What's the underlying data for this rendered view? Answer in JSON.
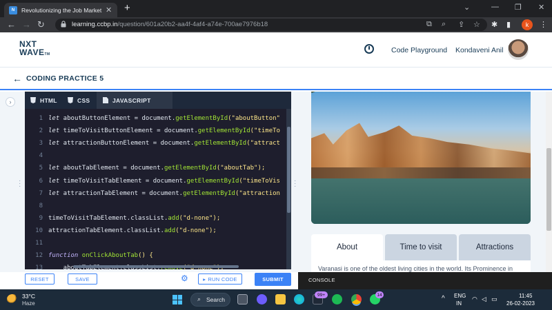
{
  "browser": {
    "tab_title": "Revolutionizing the Job Market | Nx",
    "url_host": "learning.ccbp.in",
    "url_path": "/question/601a20b2-aa4f-4af4-a74e-700ae7976b18",
    "profile_initial": "k"
  },
  "header": {
    "logo_line1": "NXT",
    "logo_line2": "WAVE",
    "logo_tm": "TM",
    "playground": "Code Playground",
    "username": "Kondaveni Anil"
  },
  "subheader": {
    "title": "CODING PRACTICE 5"
  },
  "editor": {
    "tabs": [
      {
        "label": "HTML"
      },
      {
        "label": "CSS"
      },
      {
        "label": "JAVASCRIPT"
      }
    ],
    "line_numbers": [
      "1",
      "2",
      "3",
      "4",
      "5",
      "6",
      "7",
      "8",
      "9",
      "10",
      "11",
      "12",
      "13"
    ],
    "lines": [
      {
        "kw": "let",
        "var": " aboutButtonElement = document.",
        "fn": "getElementById",
        "arg": "(\"aboutButton\""
      },
      {
        "kw": "let",
        "var": " timeToVisitButtonElement = document.",
        "fn": "getElementById",
        "arg": "(\"timeTo"
      },
      {
        "kw": "let",
        "var": " attractionButtonElement = document.",
        "fn": "getElementById",
        "arg": "(\"attract"
      },
      {
        "kw": "",
        "var": "",
        "fn": "",
        "arg": ""
      },
      {
        "kw": "let",
        "var": " aboutTabElement = document.",
        "fn": "getElementById",
        "arg": "(\"aboutTab\");"
      },
      {
        "kw": "let",
        "var": " timeToVisitTabElement = document.",
        "fn": "getElementById",
        "arg": "(\"timeToVis"
      },
      {
        "kw": "let",
        "var": " attractionTabElement = document.",
        "fn": "getElementById",
        "arg": "(\"attraction"
      },
      {
        "kw": "",
        "var": "",
        "fn": "",
        "arg": ""
      },
      {
        "kw": "",
        "var": "timeToVisitTabElement.classList.",
        "fn": "add",
        "arg": "(\"d-none\");"
      },
      {
        "kw": "",
        "var": "attractionTabElement.classList.",
        "fn": "add",
        "arg": "(\"d-none\");"
      },
      {
        "kw": "",
        "var": "",
        "fn": "",
        "arg": ""
      },
      {
        "kw": "function",
        "var": " ",
        "fn": "onClickAboutTab",
        "arg": "() {"
      },
      {
        "kw": "",
        "var": "    aboutTabElement.classList.",
        "fn": "remove",
        "arg": "(\"d-none\");"
      }
    ]
  },
  "preview": {
    "tabs": [
      {
        "label": "About"
      },
      {
        "label": "Time to visit"
      },
      {
        "label": "Attractions"
      }
    ],
    "description": "Varanasi is one of the oldest living cities in the world. Its Prominence in"
  },
  "actions": {
    "reset": "RESET",
    "save": "SAVE",
    "run": "RUN CODE",
    "submit": "SUBMIT",
    "console": "CONSOLE"
  },
  "taskbar": {
    "temperature": "33°C",
    "weather": "Haze",
    "search": "Search",
    "badge1": "99+",
    "badge2": "14",
    "lang1": "ENG",
    "lang2": "IN",
    "time": "11:45",
    "date": "26-02-2023"
  },
  "colors": {
    "accent": "#3b82f6",
    "navy": "#183b56",
    "editor_bg": "#1e1e2d"
  }
}
